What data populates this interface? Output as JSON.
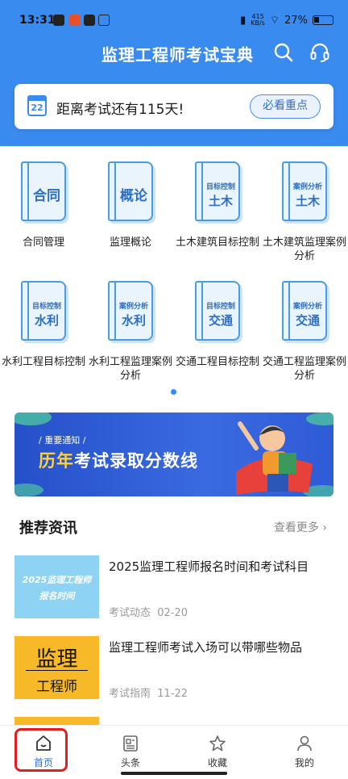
{
  "status_bar": {
    "time": "13:31",
    "net_speed_value": "415",
    "net_speed_unit": "KB/s",
    "battery": "27%"
  },
  "header": {
    "title": "监理工程师考试宝典",
    "icons": [
      "search-icon",
      "headset-icon"
    ]
  },
  "countdown": {
    "date_icon": "22",
    "text": "距离考试还有115天!",
    "button": "必看重点"
  },
  "subjects": [
    {
      "small": "",
      "big": "合同",
      "label": "合同管理"
    },
    {
      "small": "",
      "big": "概论",
      "label": "监理概论"
    },
    {
      "small": "目标控制",
      "big": "土木",
      "label": "土木建筑目标控制"
    },
    {
      "small": "案例分析",
      "big": "土木",
      "label": "土木建筑监理案例分析"
    },
    {
      "small": "目标控制",
      "big": "水利",
      "label": "水利工程目标控制"
    },
    {
      "small": "案例分析",
      "big": "水利",
      "label": "水利工程监理案例分析"
    },
    {
      "small": "目标控制",
      "big": "交通",
      "label": "交通工程目标控制"
    },
    {
      "small": "案例分析",
      "big": "交通",
      "label": "交通工程监理案例分析"
    }
  ],
  "banner": {
    "notice": "/ 重要通知 /",
    "title_highlight": "历年",
    "title_rest": "考试录取分数线"
  },
  "news_section": {
    "title": "推荐资讯",
    "more": "查看更多"
  },
  "news": [
    {
      "thumb_line1": "2025监理工程师",
      "thumb_line2": "报名时间",
      "title": "2025监理工程师报名时间和考试科目",
      "category": "考试动态",
      "date": "02-20"
    },
    {
      "thumb_line1": "监理",
      "thumb_line2": "工程师",
      "title": "监理工程师考试入场可以带哪些物品",
      "category": "考试指南",
      "date": "11-22"
    }
  ],
  "tabs": [
    {
      "label": "首页",
      "icon": "home-icon",
      "active": true
    },
    {
      "label": "头条",
      "icon": "news-icon",
      "active": false
    },
    {
      "label": "收藏",
      "icon": "star-icon",
      "active": false
    },
    {
      "label": "我的",
      "icon": "person-icon",
      "active": false
    }
  ],
  "colors": {
    "primary": "#3a8bf0",
    "accent_text": "#2a6fd8",
    "highlight": "#ffd23a",
    "annotation": "#e02020"
  }
}
